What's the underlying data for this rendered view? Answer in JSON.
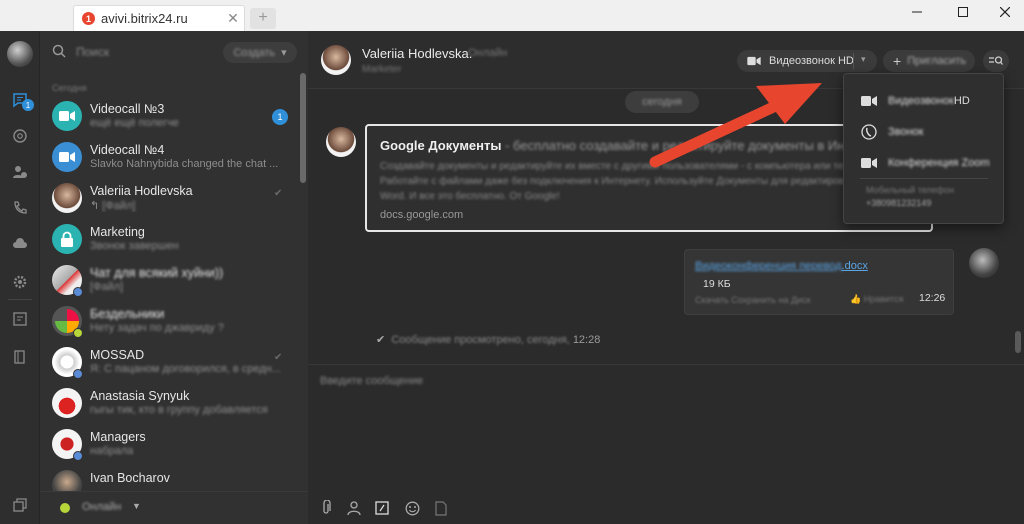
{
  "window": {
    "tab_title": "avivi.bitrix24.ru",
    "tab_close": "✕",
    "tab_new": "+",
    "favicon_badge": "1"
  },
  "colors": {
    "accent_blue": "#2f8fd8",
    "teal": "#2bb3b1",
    "online_green": "#b6d63a",
    "annotation_red": "#e8452f"
  },
  "rail": {
    "chat_badge": "1",
    "icons": [
      "chat-icon",
      "at-sign-icon",
      "contacts-icon",
      "phone-icon",
      "cloud-icon",
      "gear-icon",
      "notes-icon",
      "book-icon",
      "windows-icon"
    ]
  },
  "chatlist": {
    "search_placeholder": "Поиск",
    "create_label": "Создать",
    "section_today": "Сегодня",
    "items": [
      {
        "name": "Videocall №3",
        "preview": "ещё ещё полегче",
        "count": "1"
      },
      {
        "name": "Videocall №4",
        "preview": "Slavko Nahnybida changed the chat ..."
      },
      {
        "name": "Valeriia Hodlevska",
        "preview": "[Файл]"
      },
      {
        "name": "Marketing",
        "preview": "Звонок завершен"
      },
      {
        "name": "Чат для всякий хуйни))",
        "preview": "[Файл]"
      },
      {
        "name": "Бездельники",
        "preview": "Нету задач по джавриду ?"
      },
      {
        "name": "MOSSAD",
        "preview": "Я: С пацаном договорился, в средн..."
      },
      {
        "name": "Anastasia Synyuk",
        "preview": "гыгы тик, кто в группу добавляется"
      },
      {
        "name": "Managers",
        "preview": "набрала"
      },
      {
        "name": "Ivan Bocharov",
        "preview": ""
      }
    ],
    "status_label": "Онлайн"
  },
  "header": {
    "name": "Valeriia Hodlevska.",
    "status": "Онлайн",
    "role": "Marketer",
    "video_label": "Видеозвонок HD",
    "invite_label": "Пригласить"
  },
  "messages": {
    "date": "сегодня",
    "link": {
      "title": "Google Документы",
      "title_rest": " - бесплатно создавайте и редактируйте документы в Ин",
      "desc": "Создавайте документы и редактируйте их вместе с другими пользователями - с компьютера или телефона. Работайте с файлами даже без подключения к Интернету. Используйте Документы для редактирования файлов Word. И все это бесплатно. От Google!",
      "url": "docs.google.com"
    },
    "file": {
      "name_blur": "Видеоконференция перевод",
      "name_ext": ".docx",
      "size": "19 КБ",
      "actions": "Скачать   Сохранить на Диск",
      "like": "Нравится",
      "time": "12:26"
    },
    "read": {
      "text": "Сообщение просмотрено, сегодня,",
      "time": "12:28"
    }
  },
  "composer": {
    "placeholder": "Введите сообщение"
  },
  "dropdown": {
    "items": [
      {
        "label_blur": "Видеозвонок",
        "label_tail": " HD"
      },
      {
        "label_blur": "Звонок",
        "label_tail": ""
      },
      {
        "label_blur": "Конференция Zoom",
        "label_tail": ""
      }
    ],
    "phone_label": "Мобильный телефон",
    "phone_number": "+380981232149"
  }
}
